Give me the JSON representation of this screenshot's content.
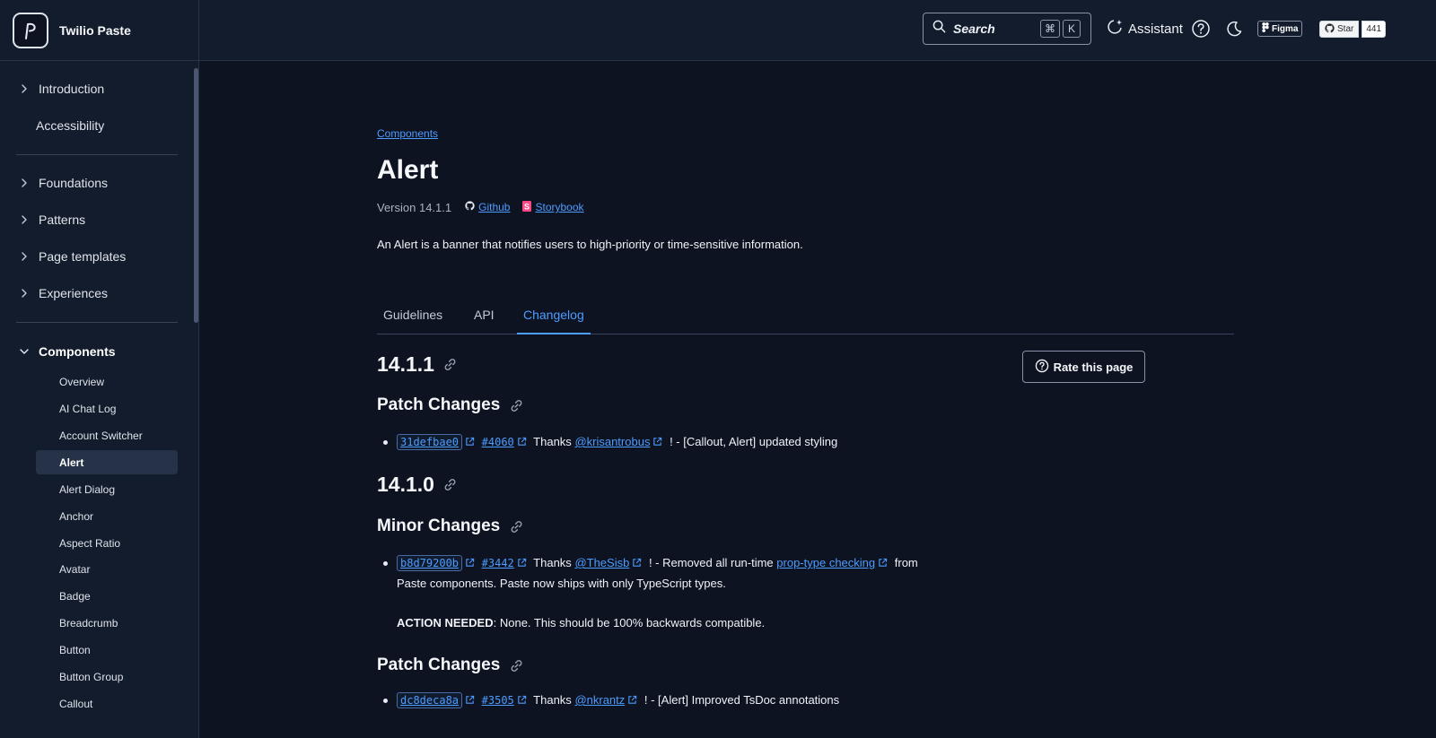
{
  "brand": {
    "name": "Twilio Paste"
  },
  "header": {
    "search_label": "Search",
    "search_kbd1": "⌘",
    "search_kbd2": "K",
    "assistant_label": "Assistant",
    "figma_label": "Figma",
    "github_star_label": "Star",
    "github_star_count": "441"
  },
  "sidebar": {
    "top": [
      "Introduction",
      "Accessibility"
    ],
    "groups": [
      "Foundations",
      "Patterns",
      "Page templates",
      "Experiences"
    ],
    "components_label": "Components",
    "components_items": [
      "Overview",
      "AI Chat Log",
      "Account Switcher",
      "Alert",
      "Alert Dialog",
      "Anchor",
      "Aspect Ratio",
      "Avatar",
      "Badge",
      "Breadcrumb",
      "Button",
      "Button Group",
      "Callout"
    ],
    "active_item": "Alert"
  },
  "page": {
    "breadcrumb": "Components",
    "title": "Alert",
    "version": "Version 14.1.1",
    "github_link": "Github",
    "storybook_link": "Storybook",
    "description": "An Alert is a banner that notifies users to high-priority or time-sensitive information.",
    "tabs": [
      "Guidelines",
      "API",
      "Changelog"
    ],
    "active_tab": "Changelog",
    "rate_button": "Rate this page"
  },
  "changelog": {
    "v1": {
      "version": "14.1.1",
      "section": "Patch Changes",
      "entry": {
        "hash": "31defbae0",
        "pr": "#4060",
        "thanks": "Thanks",
        "user": "@krisantrobus",
        "text": "! - [Callout, Alert] updated styling"
      }
    },
    "v2": {
      "version": "14.1.0",
      "minor_section": "Minor Changes",
      "minor_entry": {
        "hash": "b8d79200b",
        "pr": "#3442",
        "thanks": "Thanks",
        "user": "@TheSisb",
        "text1": "! - Removed all run-time",
        "link": "prop-type checking",
        "text2": "from",
        "text3": "Paste components. Paste now ships with only TypeScript types.",
        "action_label": "ACTION NEEDED",
        "action_text": ": None. This should be 100% backwards compatible."
      },
      "patch_section": "Patch Changes",
      "patch_entry": {
        "hash": "dc8deca8a",
        "pr": "#3505",
        "thanks": "Thanks",
        "user": "@nkrantz",
        "text": "! - [Alert] Improved TsDoc annotations"
      }
    }
  },
  "colors": {
    "background": "#0d1321",
    "surface": "#121c2d",
    "link": "#4d9cff",
    "border": "#283346"
  }
}
